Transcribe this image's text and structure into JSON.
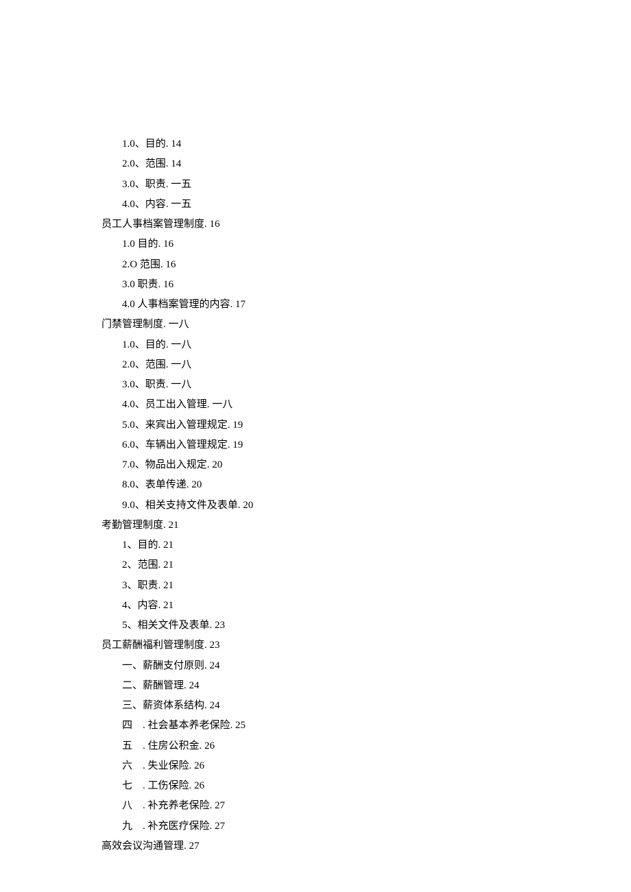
{
  "toc": [
    {
      "level": 1,
      "text": "1.0、目的. 14"
    },
    {
      "level": 1,
      "text": "2.0、范围. 14"
    },
    {
      "level": 1,
      "text": "3.0、职责. 一五"
    },
    {
      "level": 1,
      "text": "4.0、内容. 一五"
    },
    {
      "level": 0,
      "text": "员工人事档案管理制度. 16"
    },
    {
      "level": 1,
      "text": "1.0 目的. 16"
    },
    {
      "level": 1,
      "text": "2.O 范围. 16"
    },
    {
      "level": 1,
      "text": "3.0 职责. 16"
    },
    {
      "level": 1,
      "text": "4.0 人事档案管理的内容. 17"
    },
    {
      "level": 0,
      "text": "门禁管理制度. 一八"
    },
    {
      "level": 1,
      "text": "1.0、目的. 一八"
    },
    {
      "level": 1,
      "text": "2.0、范围. 一八"
    },
    {
      "level": 1,
      "text": "3.0、职责. 一八"
    },
    {
      "level": 1,
      "text": "4.0、员工出入管理. 一八"
    },
    {
      "level": 1,
      "text": "5.0、来宾出入管理规定. 19"
    },
    {
      "level": 1,
      "text": "6.0、车辆出入管理规定. 19"
    },
    {
      "level": 1,
      "text": "7.0、物品出入规定. 20"
    },
    {
      "level": 1,
      "text": "8.0、表单传递. 20"
    },
    {
      "level": 1,
      "text": "9.0、相关支持文件及表单. 20"
    },
    {
      "level": 0,
      "text": "考勤管理制度. 21"
    },
    {
      "level": 1,
      "text": "1、目的. 21"
    },
    {
      "level": 1,
      "text": "2、范围. 21"
    },
    {
      "level": 1,
      "text": "3、职责. 21"
    },
    {
      "level": 1,
      "text": "4、内容. 21"
    },
    {
      "level": 1,
      "text": "5、相关文件及表单. 23"
    },
    {
      "level": 0,
      "text": "员工薪酬福利管理制度. 23"
    },
    {
      "level": 1,
      "text": "一、薪酬支付原则. 24"
    },
    {
      "level": 1,
      "text": "二、薪酬管理. 24"
    },
    {
      "level": 1,
      "text": "三、薪资体系结构. 24"
    },
    {
      "level": 1,
      "text": "四　. 社会基本养老保险. 25"
    },
    {
      "level": 1,
      "text": "五　. 住房公积金. 26"
    },
    {
      "level": 1,
      "text": "六　. 失业保险. 26"
    },
    {
      "level": 1,
      "text": "七　. 工伤保险. 26"
    },
    {
      "level": 1,
      "text": "八　. 补充养老保险. 27"
    },
    {
      "level": 1,
      "text": "九　. 补充医疗保险. 27"
    },
    {
      "level": 0,
      "text": "高效会议沟通管理. 27"
    }
  ]
}
